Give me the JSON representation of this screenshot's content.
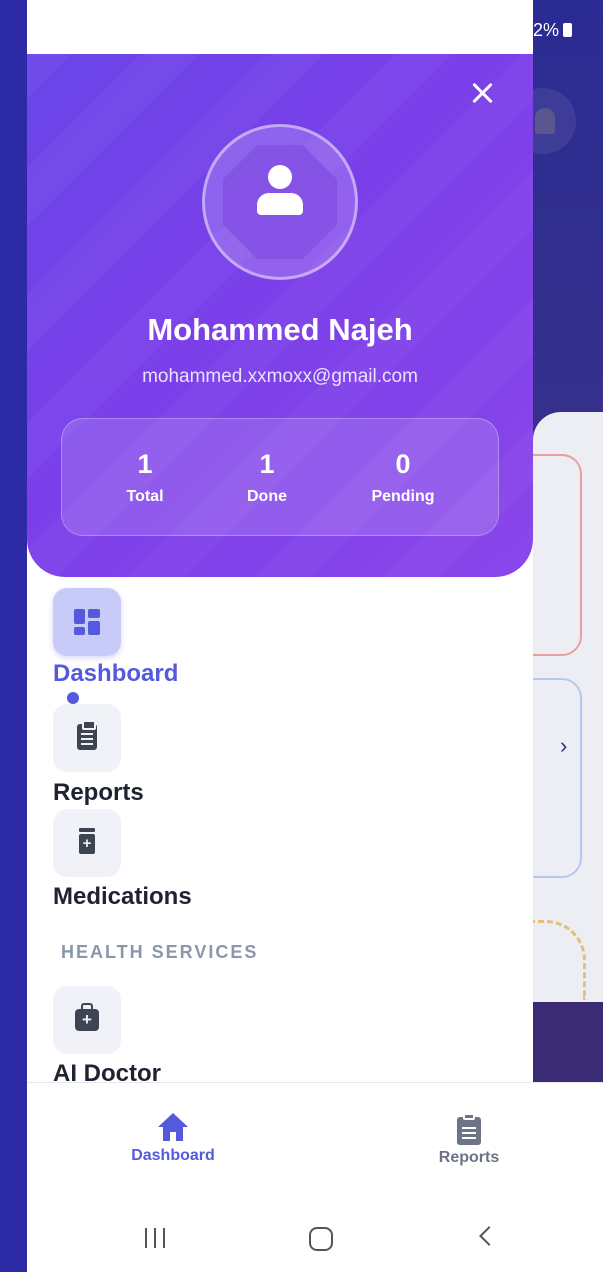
{
  "status_bar": {
    "battery_text": "2%"
  },
  "drawer": {
    "user": {
      "name": "Mohammed Najeh",
      "email": "mohammed.xxmoxx@gmail.com"
    },
    "stats": [
      {
        "value": "1",
        "label": "Total"
      },
      {
        "value": "1",
        "label": "Done"
      },
      {
        "value": "0",
        "label": "Pending"
      }
    ],
    "menu": [
      {
        "label": "Dashboard",
        "icon": "dashboard-grid-icon",
        "active": true
      },
      {
        "label": "Reports",
        "icon": "clipboard-icon",
        "active": false
      },
      {
        "label": "Medications",
        "icon": "medicine-bottle-icon",
        "active": false
      }
    ],
    "section_title": "HEALTH SERVICES",
    "services": [
      {
        "label": "AI Doctor",
        "icon": "medical-bag-icon"
      }
    ]
  },
  "bottom_nav": [
    {
      "label": "Dashboard",
      "icon": "home-icon",
      "active": true
    },
    {
      "label": "Reports",
      "icon": "clipboard-icon",
      "active": false
    }
  ],
  "colors": {
    "accent": "#5459de",
    "header_gradient_start": "#6a46e8",
    "header_gradient_end": "#8a46ea",
    "text_dark": "#1f2230",
    "section_gray": "#8a97aa"
  }
}
